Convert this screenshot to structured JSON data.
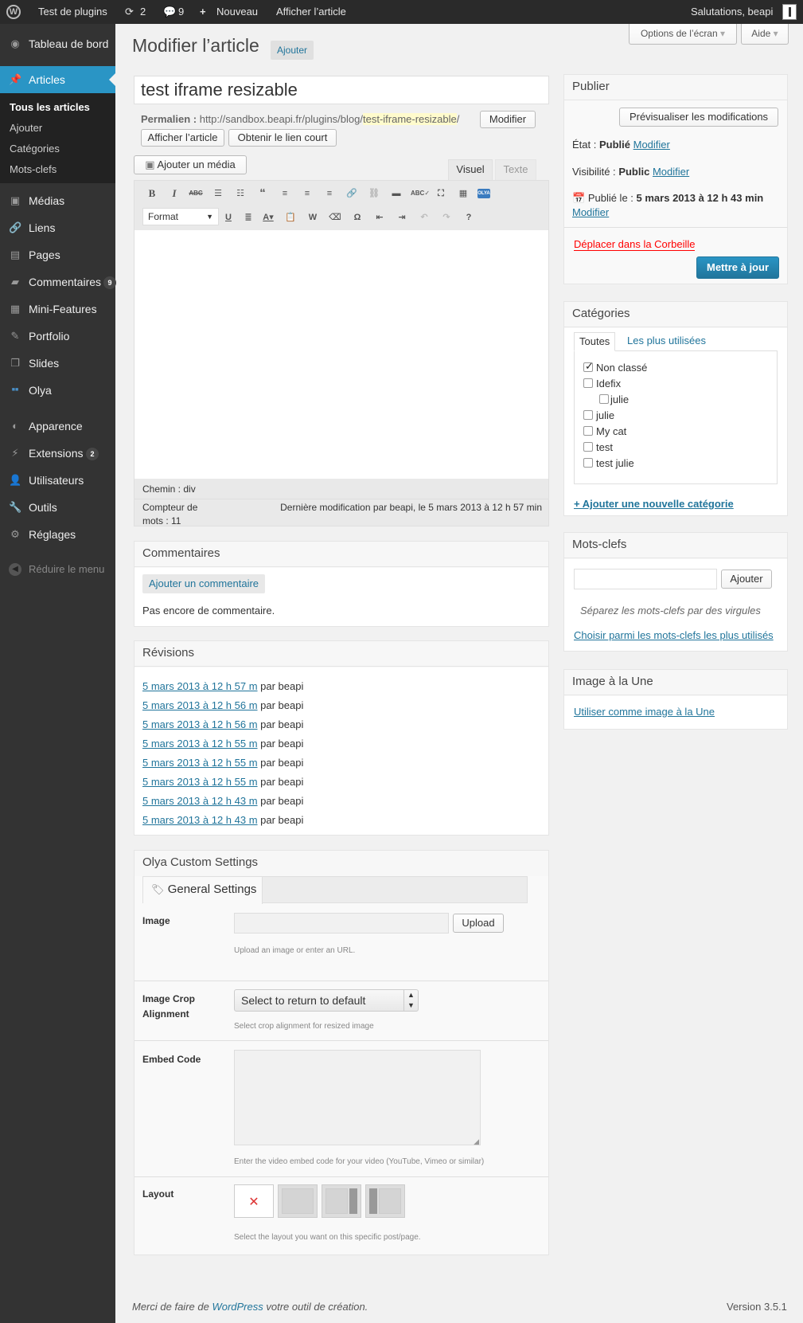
{
  "admin_bar": {
    "site_name": "Test de plugins",
    "updates_count": "2",
    "comments_count": "9",
    "new_label": "Nouveau",
    "view_post": "Afficher l’article",
    "greeting": "Salutations, beapi"
  },
  "sidebar": {
    "dashboard": "Tableau de bord",
    "articles": "Articles",
    "sub": [
      "Tous les articles",
      "Ajouter",
      "Catégories",
      "Mots-clefs"
    ],
    "medias": "Médias",
    "liens": "Liens",
    "pages": "Pages",
    "commentaires": "Commentaires",
    "commentaires_badge": "9",
    "mini_features": "Mini-Features",
    "portfolio": "Portfolio",
    "slides": "Slides",
    "olya": "Olya",
    "apparence": "Apparence",
    "extensions": "Extensions",
    "extensions_badge": "2",
    "utilisateurs": "Utilisateurs",
    "outils": "Outils",
    "reglages": "Réglages",
    "collapse": "Réduire le menu"
  },
  "screen_options": {
    "options": "Options de l’écran",
    "help": "Aide"
  },
  "page": {
    "title": "Modifier l’article",
    "add_button": "Ajouter"
  },
  "post": {
    "title": "test iframe resizable",
    "permalink_label": "Permalien :",
    "permalink_base": "http://sandbox.beapi.fr/plugins/blog/",
    "permalink_slug": "test-iframe-resizable",
    "permalink_end": "/",
    "edit_slug": "Modifier",
    "view_post": "Afficher l’article",
    "shortlink": "Obtenir le lien court",
    "add_media": "Ajouter un média",
    "tab_visual": "Visuel",
    "tab_text": "Texte",
    "format": "Format",
    "path": "Chemin : div",
    "word_count_label": "Compteur de mots : 11",
    "last_modified": "Dernière modification par beapi, le 5 mars 2013 à 12 h 57 min"
  },
  "comments_box": {
    "title": "Commentaires",
    "add": "Ajouter un commentaire",
    "empty": "Pas encore de commentaire."
  },
  "revisions": {
    "title": "Révisions",
    "by": "par beapi",
    "items": [
      "5 mars 2013 à 12 h 57 m",
      "5 mars 2013 à 12 h 56 m",
      "5 mars 2013 à 12 h 56 m",
      "5 mars 2013 à 12 h 55 m",
      "5 mars 2013 à 12 h 55 m",
      "5 mars 2013 à 12 h 55 m",
      "5 mars 2013 à 12 h 43 m",
      "5 mars 2013 à 12 h 43 m"
    ]
  },
  "olya": {
    "title": "Olya Custom Settings",
    "tab": "General Settings",
    "image_label": "Image",
    "upload": "Upload",
    "image_hint": "Upload an image or enter an URL.",
    "crop_label": "Image Crop Alignment",
    "crop_value": "Select to return to default",
    "crop_hint": "Select crop alignment for resized image",
    "embed_label": "Embed Code",
    "embed_hint": "Enter the video embed code for your video (YouTube, Vimeo or similar)",
    "layout_label": "Layout",
    "layout_hint": "Select the layout you want on this specific post/page."
  },
  "publish": {
    "title": "Publier",
    "preview": "Prévisualiser les modifications",
    "status_label": "État :",
    "status_value": "Publié",
    "visibility_label": "Visibilité :",
    "visibility_value": "Public",
    "edit": "Modifier",
    "published_on": "Publié le :",
    "published_date": "5 mars 2013 à 12 h 43 min",
    "trash": "Déplacer dans la Corbeille",
    "update": "Mettre à jour"
  },
  "categories": {
    "title": "Catégories",
    "tab_all": "Toutes",
    "tab_popular": "Les plus utilisées",
    "items": [
      "Non classé",
      "Idefix",
      "julie",
      "julie",
      "My cat",
      "test",
      "test julie"
    ],
    "add_new": "+ Ajouter une nouvelle catégorie"
  },
  "tags": {
    "title": "Mots-clefs",
    "add": "Ajouter",
    "hint": "Séparez les mots-clefs par des virgules",
    "choose": "Choisir parmi les mots-clefs les plus utilisés"
  },
  "featured": {
    "title": "Image à la Une",
    "set": "Utiliser comme image à la Une"
  },
  "footer": {
    "thanks_pre": "Merci de faire de",
    "thanks_link": "WordPress",
    "thanks_post": "votre outil de création.",
    "version": "Version 3.5.1"
  }
}
